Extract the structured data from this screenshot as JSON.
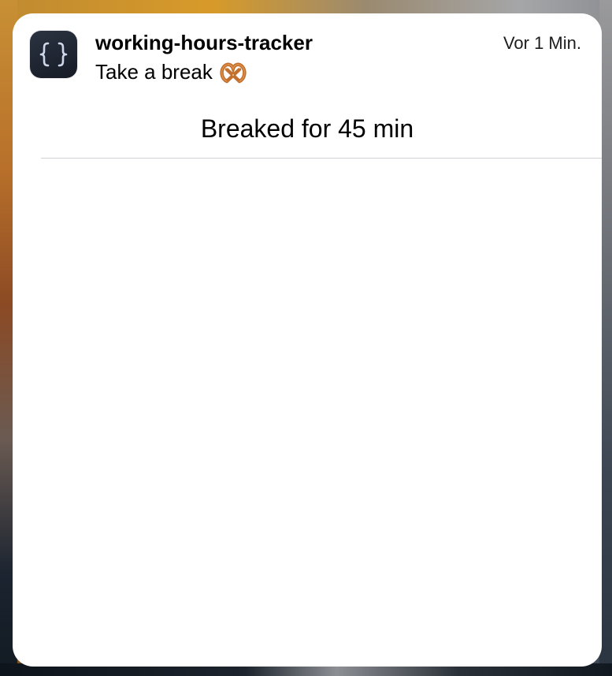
{
  "notification": {
    "app_name": "working-hours-tracker",
    "timestamp": "Vor 1 Min.",
    "title": "Take a break",
    "title_emoji": "🥨",
    "body": "Breaked for 45 min",
    "app_icon": {
      "name": "curly-braces-icon",
      "glyph": "{ }",
      "background": "#1d2230",
      "glyph_color": "#cfd8ea"
    }
  },
  "colors": {
    "card_background": "#ffffff",
    "text_primary": "#000000",
    "divider": "#d1d1d6"
  }
}
